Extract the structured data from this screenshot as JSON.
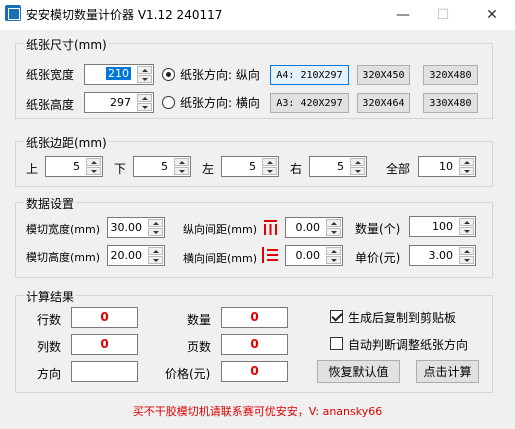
{
  "window": {
    "title": "安安模切数量计价器 V1.12 240117",
    "min_glyph": "—",
    "max_glyph": "☐",
    "close_glyph": "✕"
  },
  "paper_size": {
    "group_title": "纸张尺寸(mm)",
    "width_label": "纸张宽度",
    "width_value": "210",
    "height_label": "纸张高度",
    "height_value": "297",
    "orientation_portrait_label": "纸张方向: 纵向",
    "orientation_landscape_label": "纸张方向: 横向",
    "orientation_selected": "portrait",
    "presets_row1": [
      "A4: 210X297",
      "320X450",
      "320X480"
    ],
    "presets_row2": [
      "A3: 420X297",
      "320X464",
      "330X480"
    ]
  },
  "margins": {
    "group_title": "纸张边距(mm)",
    "top_label": "上",
    "top_value": "5",
    "bottom_label": "下",
    "bottom_value": "5",
    "left_label": "左",
    "left_value": "5",
    "right_label": "右",
    "right_value": "5",
    "all_label": "全部",
    "all_value": "10"
  },
  "data_settings": {
    "group_title": "数据设置",
    "die_width_label": "模切宽度(mm)",
    "die_width_value": "30.00",
    "die_height_label": "模切高度(mm)",
    "die_height_value": "20.00",
    "v_spacing_label": "纵向间距(mm)",
    "v_spacing_value": "0.00",
    "h_spacing_label": "横向间距(mm)",
    "h_spacing_value": "0.00",
    "quantity_label": "数量(个)",
    "quantity_value": "100",
    "unit_price_label": "单价(元)",
    "unit_price_value": "3.00",
    "accent_color": "#e00000"
  },
  "results": {
    "group_title": "计算结果",
    "rows_label": "行数",
    "rows_value": "0",
    "cols_label": "列数",
    "cols_value": "0",
    "direction_label": "方向",
    "direction_value": "",
    "count_label": "数量",
    "count_value": "0",
    "pages_label": "页数",
    "pages_value": "0",
    "price_label": "价格(元)",
    "price_value": "0",
    "copy_checkbox_label": "生成后复制到剪贴板",
    "copy_checked": true,
    "auto_orient_label": "自动判断调整纸张方向",
    "auto_orient_checked": false,
    "reset_button": "恢复默认值",
    "calc_button": "点击计算"
  },
  "footer": {
    "text": "买不干胶模切机请联系赛可优安安，V: anansky66"
  }
}
